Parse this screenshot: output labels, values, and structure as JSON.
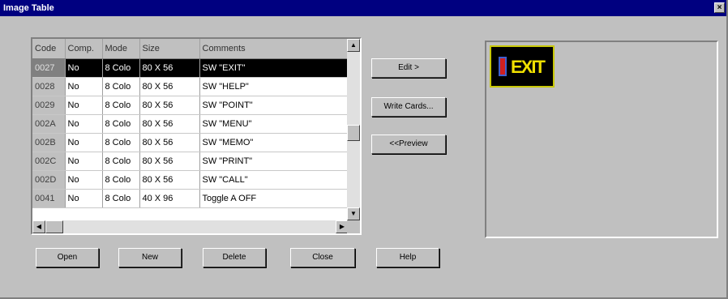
{
  "window": {
    "title": "Image Table",
    "close_glyph": "×"
  },
  "grid": {
    "columns": [
      "Code",
      "Comp.",
      "Mode",
      "Size",
      "Comments"
    ],
    "rows": [
      [
        "0027",
        "No",
        "8 Colo",
        "80 X 56",
        "SW \"EXIT\""
      ],
      [
        "0028",
        "No",
        "8 Colo",
        "80 X 56",
        "SW \"HELP\""
      ],
      [
        "0029",
        "No",
        "8 Colo",
        "80 X 56",
        "SW \"POINT\""
      ],
      [
        "002A",
        "No",
        "8 Colo",
        "80 X 56",
        "SW \"MENU\""
      ],
      [
        "002B",
        "No",
        "8 Colo",
        "80 X 56",
        "SW \"MEMO\""
      ],
      [
        "002C",
        "No",
        "8 Colo",
        "80 X 56",
        "SW \"PRINT\""
      ],
      [
        "002D",
        "No",
        "8 Colo",
        "80 X 56",
        "SW \"CALL\""
      ],
      [
        "0041",
        "No",
        "8 Colo",
        "40 X 96",
        "Toggle A OFF"
      ]
    ],
    "selected_row": 0,
    "scroll_arrows": {
      "up": "▲",
      "down": "▼",
      "left": "◀",
      "right": "▶"
    }
  },
  "side_buttons": {
    "edit": "Edit >",
    "write_cards": "Write Cards...",
    "preview": "<<Preview"
  },
  "bottom_buttons": {
    "open": "Open",
    "new": "New",
    "delete": "Delete",
    "close": "Close",
    "help": "Help"
  },
  "preview": {
    "sign_text": "EXIT",
    "sign_text_color": "#f0e000",
    "door_color": "#d02020"
  },
  "colors": {
    "titlebar": "#000080",
    "face": "#c0c0c0",
    "selection": "#000000"
  }
}
